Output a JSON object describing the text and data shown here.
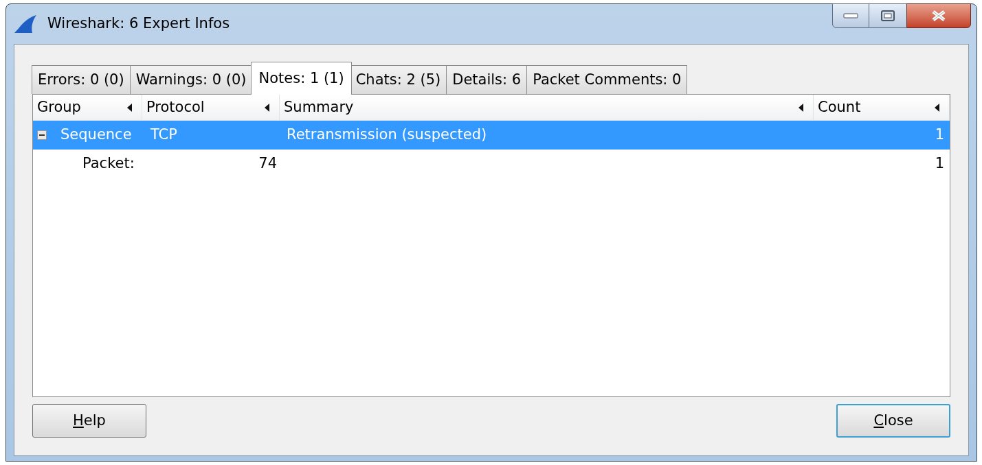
{
  "window": {
    "title": "Wireshark: 6 Expert Infos"
  },
  "tabs": [
    {
      "label": "Errors: 0 (0)",
      "selected": false
    },
    {
      "label": "Warnings: 0 (0)",
      "selected": false
    },
    {
      "label": "Notes: 1 (1)",
      "selected": true
    },
    {
      "label": "Chats: 2 (5)",
      "selected": false
    },
    {
      "label": "Details: 6",
      "selected": false
    },
    {
      "label": "Packet Comments: 0",
      "selected": false
    }
  ],
  "table": {
    "columns": [
      "Group",
      "Protocol",
      "Summary",
      "Count"
    ],
    "rows": [
      {
        "group": "Sequence",
        "protocol": "TCP",
        "summary": "Retransmission (suspected)",
        "count": "1",
        "expanded": true,
        "selected": true,
        "children": [
          {
            "group": "Packet:",
            "protocol": "74",
            "count": "1",
            "selected": false
          }
        ]
      }
    ]
  },
  "buttons": [
    {
      "underlined": "H",
      "rest": "elp",
      "default": false
    },
    {
      "underlined": "C",
      "rest": "lose",
      "default": true
    }
  ]
}
